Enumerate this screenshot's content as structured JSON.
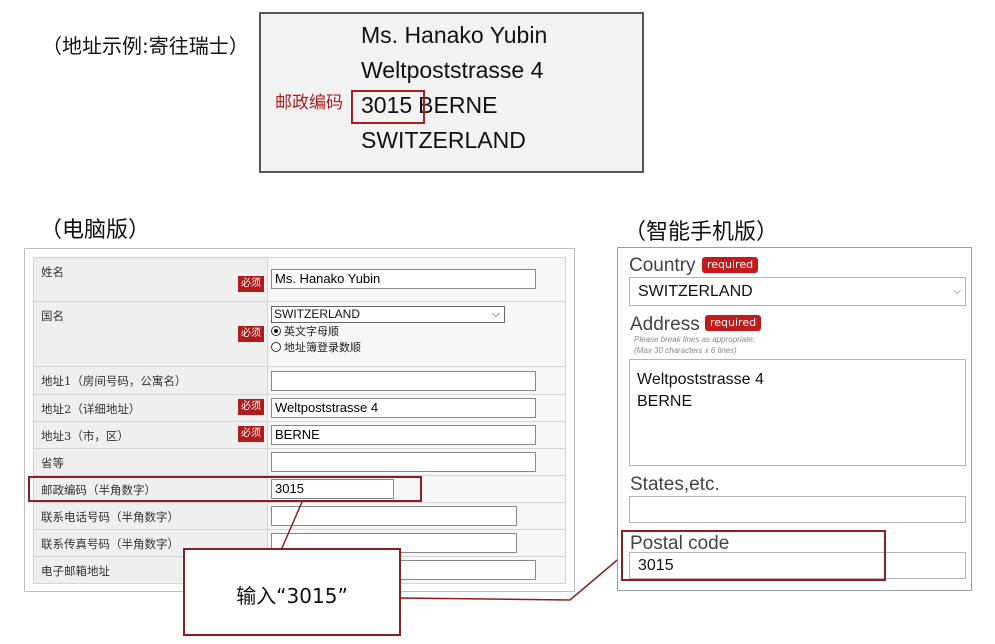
{
  "example": {
    "label": "（地址示例:寄往瑞士）",
    "lines": [
      "Ms. Hanako Yubin",
      "Weltpoststrasse 4",
      "3015 BERNE",
      "SWITZERLAND"
    ],
    "postal_label": "邮政编码",
    "postal_code": "3015",
    "city": "BERNE"
  },
  "pc": {
    "title": "（电脑版）",
    "required_badge": "必须",
    "rows": [
      {
        "label": "姓名",
        "value": "Ms. Hanako Yubin",
        "required": true
      },
      {
        "label": "国名",
        "value": "SWITZERLAND",
        "required": true
      },
      {
        "label": "地址1（房间号码，公寓名）",
        "value": "",
        "required": false
      },
      {
        "label": "地址2（详细地址）",
        "value": "Weltpoststrasse 4",
        "required": true
      },
      {
        "label": "地址3（市，区）",
        "value": "BERNE",
        "required": true
      },
      {
        "label": "省等",
        "value": "",
        "required": false
      },
      {
        "label": "邮政编码（半角数字）",
        "value": "3015",
        "required": false
      },
      {
        "label": "联系电话号码（半角数字）",
        "value": "",
        "required": false
      },
      {
        "label": "联系传真号码（半角数字）",
        "value": "",
        "required": false
      },
      {
        "label": "电子邮箱地址",
        "value": "",
        "required": false
      }
    ],
    "sort_options": [
      "英文字母顺",
      "地址簿登录数顺"
    ],
    "sort_selected": "英文字母顺"
  },
  "callout": {
    "text": "输入“3015”"
  },
  "smartphone": {
    "title": "（智能手机版）",
    "required_badge": "required",
    "country_label": "Country",
    "country_value": "SWITZERLAND",
    "address_label": "Address",
    "address_note1": "Please break lines as appropriate.",
    "address_note2": "(Max 30 characters x 6 lines)",
    "address_line1": "Weltpoststrasse 4",
    "address_line2": "BERNE",
    "states_label": "States,etc.",
    "states_value": "",
    "postal_label": "Postal code",
    "postal_value": "3015"
  },
  "colors": {
    "accent": "#b01c1c",
    "callout_border": "#8f1d1d"
  }
}
